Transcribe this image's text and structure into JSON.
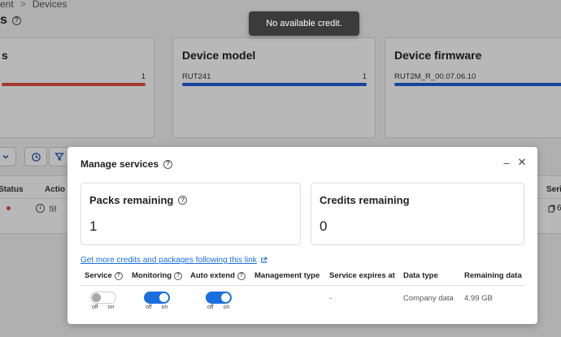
{
  "breadcrumb": {
    "parent": "ent",
    "separator": ">",
    "current": "Devices"
  },
  "page": {
    "title_partial": "s"
  },
  "cards": [
    {
      "title": "s",
      "row_label": "",
      "row_value": "1",
      "bar_color": "#e1523d"
    },
    {
      "title": "Device model",
      "row_label": "RUT241",
      "row_value": "1",
      "bar_color": "#1f5fd8"
    },
    {
      "title": "Device firmware",
      "row_label": "RUT2M_R_00.07.06.10",
      "row_value": "",
      "bar_color": "#1f5fd8"
    }
  ],
  "table": {
    "headers": {
      "status": "Status",
      "actions": "Actio",
      "serial": "Seri"
    },
    "row": {
      "serial_partial": "6"
    }
  },
  "toast": {
    "message": "No available credit."
  },
  "modal": {
    "title": "Manage services",
    "minimize_label": "–",
    "close_label": "✕",
    "packs": {
      "label": "Packs remaining",
      "value": "1"
    },
    "credits": {
      "label": "Credits remaining",
      "value": "0"
    },
    "link": {
      "text": "Get more credits and packages following this link"
    },
    "columns": {
      "service": "Service",
      "monitoring": "Monitoring",
      "auto_extend": "Auto extend",
      "management_type": "Management type",
      "service_expires": "Service expires at",
      "data_type": "Data type",
      "remaining_data": "Remaining data"
    },
    "toggle_off": "off",
    "toggle_on": "on",
    "row": {
      "service_enabled": false,
      "monitoring_enabled": true,
      "auto_extend_enabled": true,
      "service_expires": "-",
      "data_type": "Company data",
      "remaining_data": "4.99 GB"
    }
  },
  "colors": {
    "accent": "#1a6fe0",
    "toggle_on": "#1a6fe0",
    "toggle_off": "#bdbdbd"
  }
}
